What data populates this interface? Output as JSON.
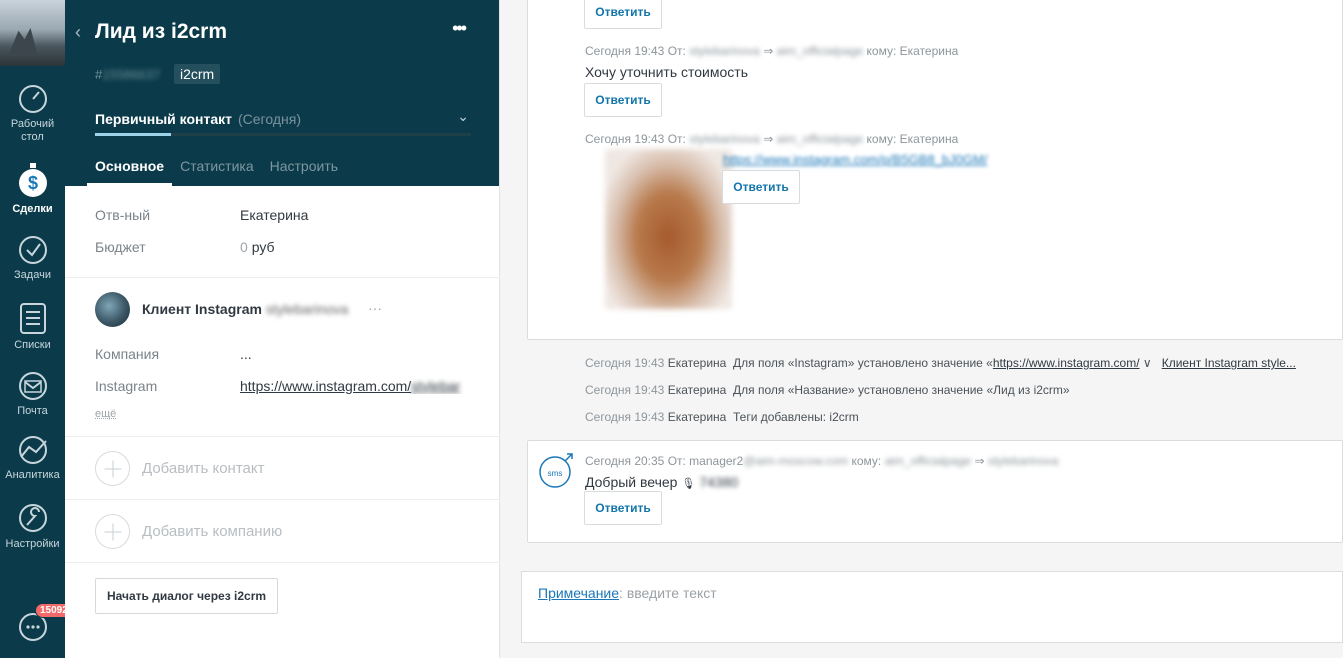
{
  "nav": {
    "items": [
      {
        "label": "Рабочий стол",
        "icon": "dashboard-icon"
      },
      {
        "label": "Сделки",
        "icon": "deals-icon"
      },
      {
        "label": "Задачи",
        "icon": "tasks-icon"
      },
      {
        "label": "Списки",
        "icon": "lists-icon"
      },
      {
        "label": "Почта",
        "icon": "mail-icon"
      },
      {
        "label": "Аналитика",
        "icon": "analytics-icon"
      },
      {
        "label": "Настройки",
        "icon": "settings-icon"
      }
    ],
    "chat_badge": "15092"
  },
  "card": {
    "title": "Лид из i2crm",
    "lead_id_prefix": "#",
    "lead_id": "15586637",
    "tag": "i2crm",
    "stage": "Первичный контакт",
    "stage_date": "(Сегодня)",
    "tabs": [
      "Основное",
      "Статистика",
      "Настроить"
    ],
    "responsible_label": "Отв-ный",
    "responsible_value": "Екатерина",
    "budget_label": "Бюджет",
    "budget_value": "0",
    "budget_currency": "руб",
    "contact_name": "Клиент Instagram",
    "contact_handle": "stylebarinova",
    "contact_more": "···",
    "company_label": "Компания",
    "company_value": "...",
    "instagram_label": "Instagram",
    "instagram_value": "https://www.instagram.com/",
    "instagram_value_tail": "stylebar",
    "more_link": "ещё",
    "add_contact": "Добавить контакт",
    "add_company": "Добавить компанию",
    "dialog_button": "Начать диалог через i2crm"
  },
  "feed": {
    "reply_label": "Ответить",
    "messages": [
      {
        "meta_prefix": "Сегодня 19:43 От:",
        "from": "stylebarinova",
        "arrow": "⇒",
        "to_page": "aim_officialpage",
        "to_label": "кому: Екатерина",
        "text": "Хочу уточнить стоимость"
      },
      {
        "meta_prefix": "Сегодня 19:43 От:",
        "from": "stylebarinova",
        "arrow": "⇒",
        "to_page": "aim_officialpage",
        "to_label": "кому: Екатерина",
        "link": "https://www.instagram.com/p/B5GB8_bJ0GM/"
      }
    ],
    "system": [
      {
        "time": "Сегодня 19:43",
        "user": "Екатерина",
        "text": "Для поля «Instagram» установлено значение «",
        "link": "https://www.instagram.com/",
        "chevron": "∨",
        "link2": "Клиент Instagram style..."
      },
      {
        "time": "Сегодня 19:43",
        "user": "Екатерина",
        "text": "Для поля «Название» установлено значение «Лид из i2crm»"
      },
      {
        "time": "Сегодня 19:43",
        "user": "Екатерина",
        "text": "Теги добавлены: i2crm"
      }
    ],
    "sms": {
      "meta_prefix": "Сегодня 20:35 От: manager2",
      "from_domain": "@aim-moscow.com",
      "to_label": "кому:",
      "to_page": "aim_officialpage",
      "arrow": "⇒",
      "to_user": "stylebarinova",
      "text": "Добрый вечер",
      "text_blur": "74380"
    },
    "note": {
      "link": "Примечание",
      "placeholder": ": введите текст"
    }
  },
  "colors": {
    "nav_bg": "#0b3b4a",
    "accent": "#1a77b8",
    "stage_progress": "#9fd3ea",
    "badge": "#f46a6a"
  }
}
